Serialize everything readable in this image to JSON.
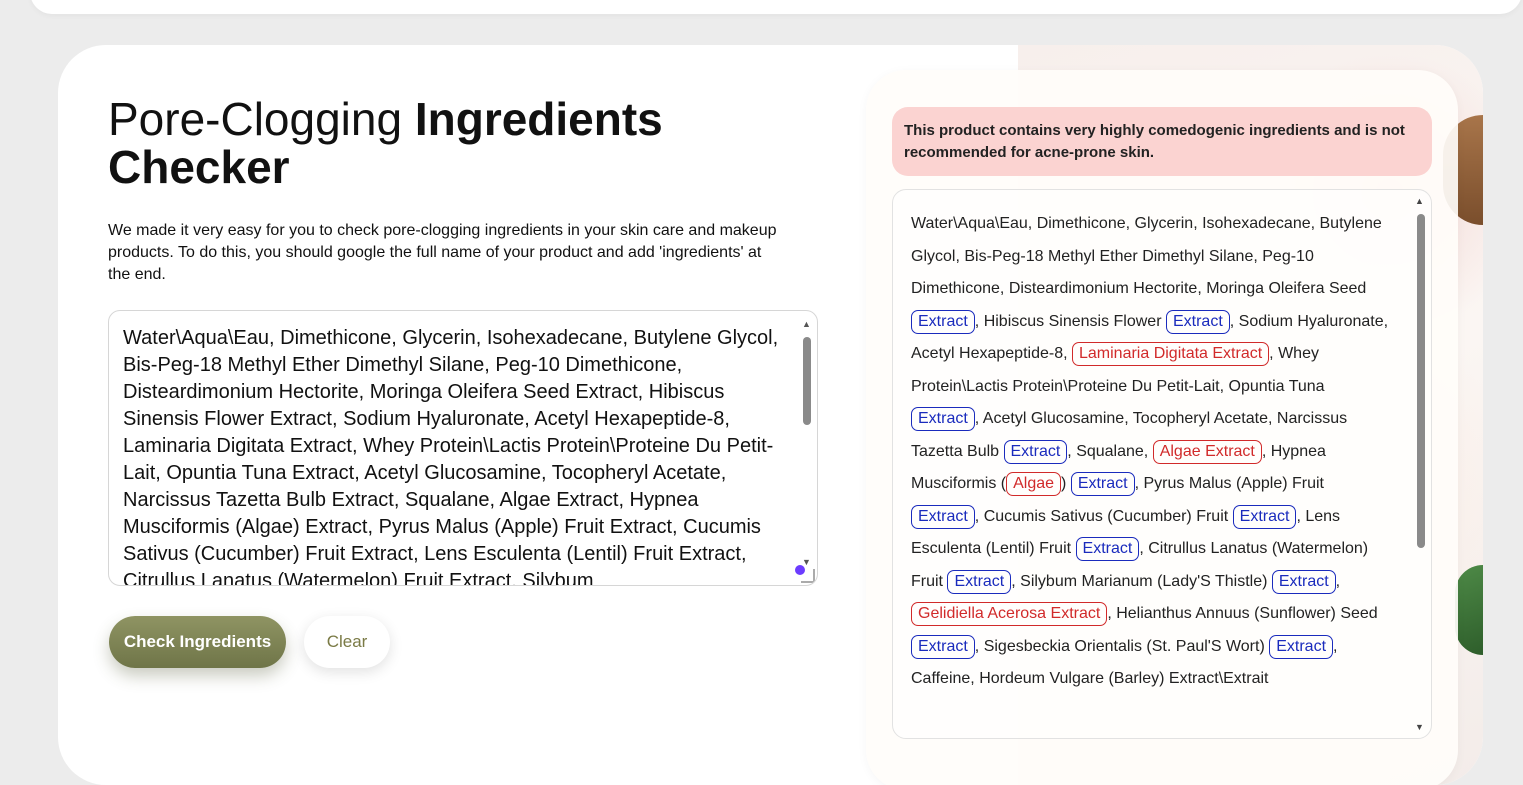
{
  "title": {
    "light": "Pore-Clogging ",
    "bold_1": "Ingredients",
    "bold_2": "Checker"
  },
  "intro": "We made it very easy for you to check pore-clogging ingredients in your skin care and makeup products. To do this, you should google the full name of your product and add 'ingredients' at the end.",
  "input": {
    "value": "Water\\Aqua\\Eau, Dimethicone, Glycerin, Isohexadecane, Butylene Glycol, Bis-Peg-18 Methyl Ether Dimethyl Silane, Peg-10 Dimethicone, Disteardimonium Hectorite, Moringa Oleifera Seed Extract, Hibiscus Sinensis Flower Extract, Sodium Hyaluronate, Acetyl Hexapeptide-8, Laminaria Digitata Extract, Whey Protein\\Lactis Protein\\Proteine Du Petit-Lait, Opuntia Tuna Extract, Acetyl Glucosamine, Tocopheryl Acetate, Narcissus Tazetta Bulb Extract, Squalane, Algae Extract, Hypnea Musciformis (Algae) Extract, Pyrus Malus (Apple) Fruit Extract, Cucumis Sativus (Cucumber) Fruit Extract, Lens Esculenta (Lentil) Fruit Extract, Citrullus Lanatus (Watermelon) Fruit Extract, Silybum"
  },
  "buttons": {
    "check": "Check Ingredients",
    "clear": "Clear"
  },
  "result": {
    "warning": "This product contains very highly comedogenic ingredients and is not recommended for acne-prone skin.",
    "segments": [
      {
        "t": "Water\\Aqua\\Eau, Dimethicone, Glycerin, Isohexadecane, Butylene Glycol, Bis-Peg-18 Methyl Ether Dimethyl Silane, Peg-10 Dimethicone, Disteardimonium Hectorite, Moringa Oleifera Seed "
      },
      {
        "t": "Extract",
        "k": "blue"
      },
      {
        "t": ", Hibiscus Sinensis Flower "
      },
      {
        "t": "Extract",
        "k": "blue"
      },
      {
        "t": ", Sodium Hyaluronate, Acetyl Hexapeptide-8, "
      },
      {
        "t": "Laminaria Digitata Extract",
        "k": "red"
      },
      {
        "t": ", Whey Protein\\Lactis Protein\\Proteine Du Petit-Lait, Opuntia Tuna "
      },
      {
        "t": "Extract",
        "k": "blue"
      },
      {
        "t": ", Acetyl Glucosamine, Tocopheryl Acetate, Narcissus Tazetta Bulb "
      },
      {
        "t": "Extract",
        "k": "blue"
      },
      {
        "t": ", Squalane, "
      },
      {
        "t": "Algae Extract",
        "k": "red"
      },
      {
        "t": ", Hypnea Musciformis ("
      },
      {
        "t": "Algae",
        "k": "red"
      },
      {
        "t": ") "
      },
      {
        "t": "Extract",
        "k": "blue"
      },
      {
        "t": ", Pyrus Malus (Apple) Fruit "
      },
      {
        "t": "Extract",
        "k": "blue"
      },
      {
        "t": ", Cucumis Sativus (Cucumber) Fruit "
      },
      {
        "t": "Extract",
        "k": "blue"
      },
      {
        "t": ", Lens Esculenta (Lentil) Fruit "
      },
      {
        "t": "Extract",
        "k": "blue"
      },
      {
        "t": ", Citrullus Lanatus (Watermelon) Fruit "
      },
      {
        "t": "Extract",
        "k": "blue"
      },
      {
        "t": ", Silybum Marianum (Lady'S Thistle) "
      },
      {
        "t": "Extract",
        "k": "blue"
      },
      {
        "t": ", "
      },
      {
        "t": "Gelidiella Acerosa Extract",
        "k": "red"
      },
      {
        "t": ", Helianthus Annuus (Sunflower) Seed "
      },
      {
        "t": "Extract",
        "k": "blue"
      },
      {
        "t": ", Sigesbeckia Orientalis (St. Paul'S Wort) "
      },
      {
        "t": "Extract",
        "k": "blue"
      },
      {
        "t": ", Caffeine, Hordeum Vulgare (Barley) Extract\\Extrait"
      }
    ]
  },
  "colors": {
    "accent": "#7f8556",
    "warning_bg": "#fbd3d1",
    "tag_blue": "#1a2bbd",
    "tag_red": "#d12a2a"
  }
}
